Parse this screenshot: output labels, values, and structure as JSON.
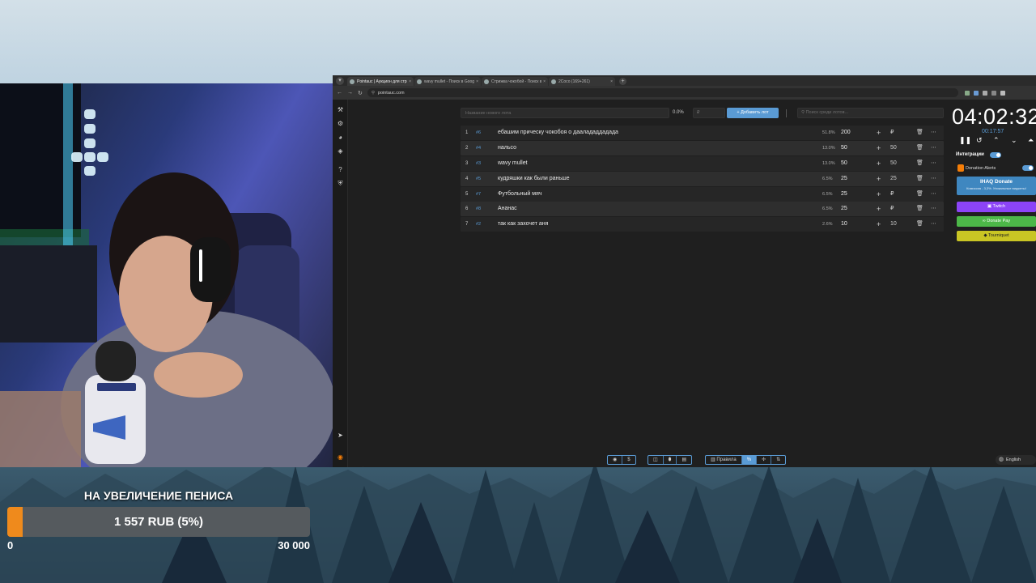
{
  "browser": {
    "tabs": [
      {
        "label": "Pointauc | Аукцион для стримеров",
        "active": true
      },
      {
        "label": "wavy mullet - Поиск в Google",
        "active": false
      },
      {
        "label": "Стрижка чокобой - Поиск в Google",
        "active": false
      },
      {
        "label": "2Сосо (169+261)",
        "active": false
      }
    ],
    "url": "pointauc.com"
  },
  "auction": {
    "lot_name_placeholder": "Название нового лота",
    "percent": "0.0%",
    "price_placeholder": "₽",
    "add_lot_label": "Добавить лот",
    "search_placeholder": "Поиск среди лотов...",
    "lots": [
      {
        "num": "1",
        "id": "#6",
        "name": "ебашим прическу чокобоя о даалададдадада",
        "pct": "51.8%",
        "amount": "200",
        "add": "₽"
      },
      {
        "num": "2",
        "id": "#4",
        "name": "нальсо",
        "pct": "13.0%",
        "amount": "50",
        "add": "50"
      },
      {
        "num": "3",
        "id": "#3",
        "name": "wavy mullet",
        "pct": "13.0%",
        "amount": "50",
        "add": "50"
      },
      {
        "num": "4",
        "id": "#5",
        "name": "кудряшки как были раньше",
        "pct": "6.5%",
        "amount": "25",
        "add": "25"
      },
      {
        "num": "5",
        "id": "#7",
        "name": "Футбольный мяч",
        "pct": "6.5%",
        "amount": "25",
        "add": "₽"
      },
      {
        "num": "6",
        "id": "#8",
        "name": "Ананас",
        "pct": "6.5%",
        "amount": "25",
        "add": "₽"
      },
      {
        "num": "7",
        "id": "#2",
        "name": "так как захочет аня",
        "pct": "2.6%",
        "amount": "10",
        "add": "10"
      }
    ]
  },
  "timer": {
    "main": "04:02:32",
    "sub": "00:17:57"
  },
  "integrations": {
    "label": "Интеграции",
    "donation_alerts": "Donation Alerts",
    "ihaq_title": "IHAQ Donate",
    "ihaq_sub": "Комиссия - 3,3%. Уникальные виджеты!",
    "twitch": "Twitch",
    "donatepay": "Donate Pay",
    "tourniquet": "Tourniquet"
  },
  "bottom_bar": {
    "rules": "Правила"
  },
  "language": "English",
  "goal": {
    "title": "НА УВЕЛИЧЕНИЕ ПЕНИСА",
    "amount": "1 557 RUB (5%)",
    "progress": 0.052,
    "min": "0",
    "max": "30 000"
  },
  "colors": {
    "accent": "#5a9bd5",
    "goal_fill": "#ef8a1c",
    "twitch": "#8c44f7",
    "donatepay": "#4cb748",
    "tourniquet": "#c9c524"
  }
}
